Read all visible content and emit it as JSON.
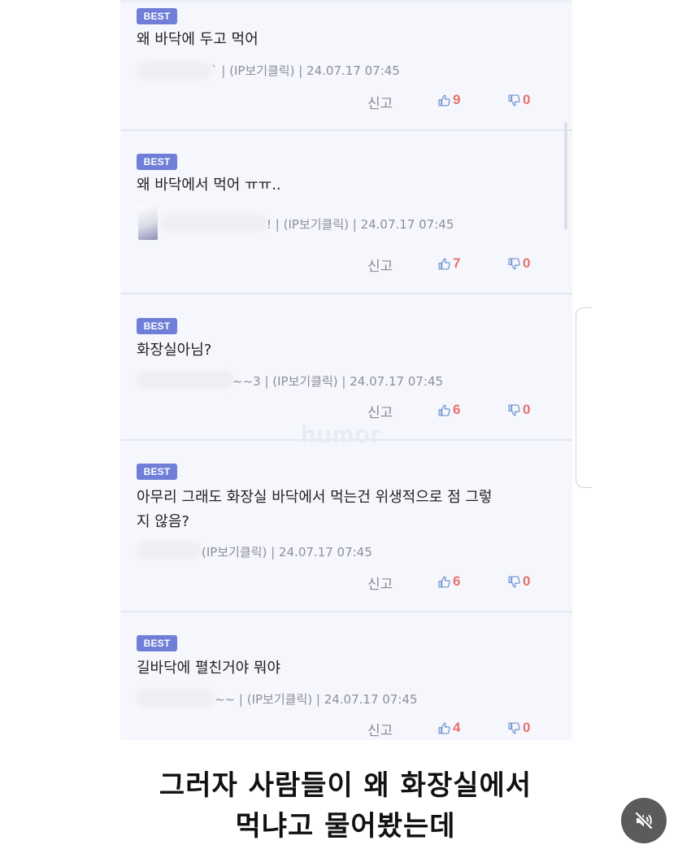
{
  "comments": [
    {
      "badge": "BEST",
      "text": "왜 바닥에 두고 먹어",
      "meta": "` | (IP보기클릭) | 24.07.17 07:45",
      "report": "신고",
      "likes": "9",
      "dislikes": "0"
    },
    {
      "badge": "BEST",
      "text": "왜 바닥에서 먹어 ㅠㅠ..",
      "meta": "! | (IP보기클릭) | 24.07.17 07:45",
      "report": "신고",
      "likes": "7",
      "dislikes": "0"
    },
    {
      "badge": "BEST",
      "text": "화장실아님?",
      "meta": "~~3 | (IP보기클릭) | 24.07.17 07:45",
      "report": "신고",
      "likes": "6",
      "dislikes": "0"
    },
    {
      "badge": "BEST",
      "text_line1": "아무리 그래도 화장실 바닥에서 먹는건 위생적으로 점 그렇",
      "text_line2": "지 않음?",
      "meta": "(IP보기클릭) | 24.07.17 07:45",
      "report": "신고",
      "likes": "6",
      "dislikes": "0"
    },
    {
      "badge": "BEST",
      "text": "길바닥에 펼친거야 뭐야",
      "meta": "~~ | (IP보기클릭) | 24.07.17 07:45",
      "report": "신고",
      "likes": "4",
      "dislikes": "0"
    }
  ],
  "watermark": "humor",
  "caption": {
    "line1": "그러자 사람들이 왜 화장실에서",
    "line2": "먹냐고 물어봤는데"
  },
  "icons": {
    "like": "thumbs-up-icon",
    "dislike": "thumbs-down-icon",
    "mute": "speaker-muted-icon"
  },
  "colors": {
    "badge": "#6f7fd8",
    "vote_count": "#e9706f",
    "panel_bg": "#f5f7fd"
  }
}
